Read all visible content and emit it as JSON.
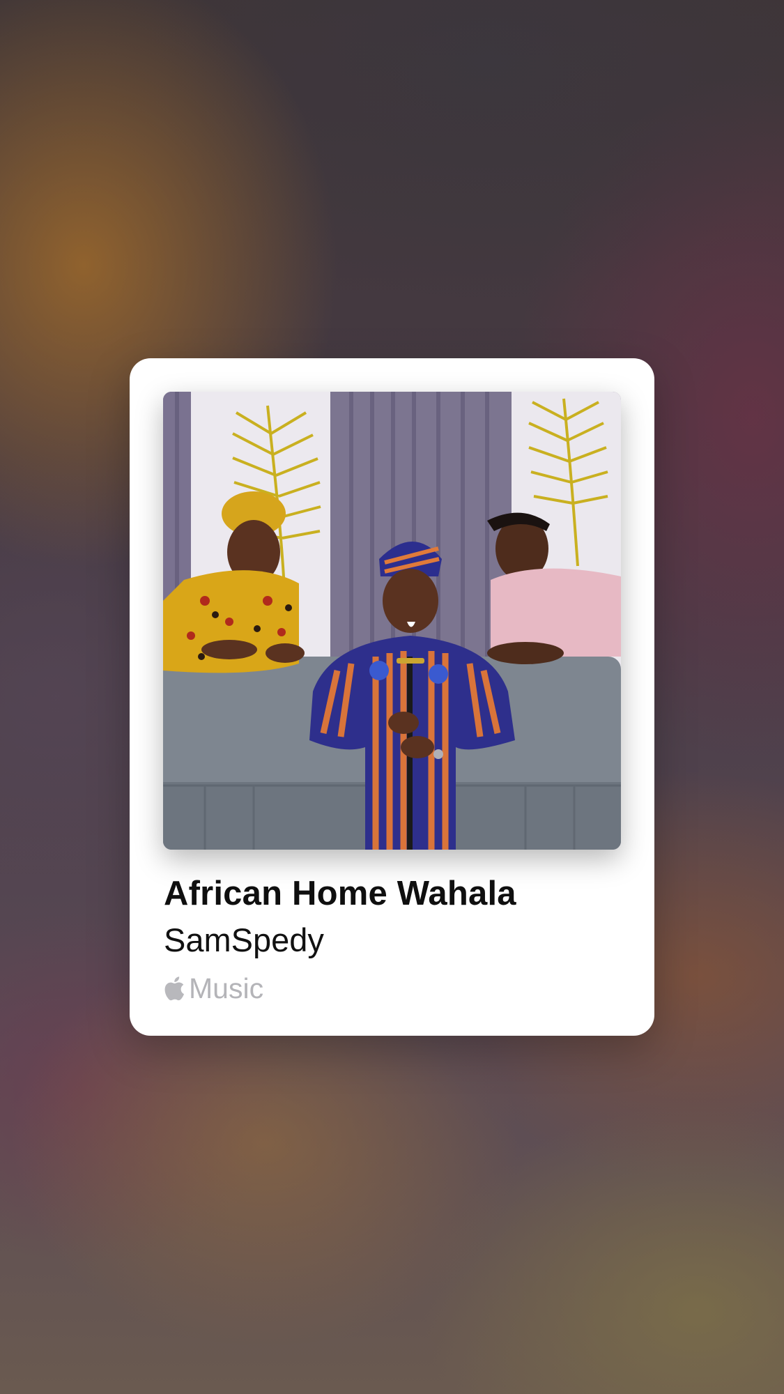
{
  "song": {
    "title": "African Home Wahala",
    "artist": "SamSpedy"
  },
  "brand": {
    "label": "Music",
    "icon": "apple-logo-icon"
  },
  "artwork": {
    "description_icon": "album-artwork"
  },
  "colors": {
    "card_background": "#ffffff",
    "title_text": "#0f0f0f",
    "brand_text": "#b4b4b8"
  }
}
